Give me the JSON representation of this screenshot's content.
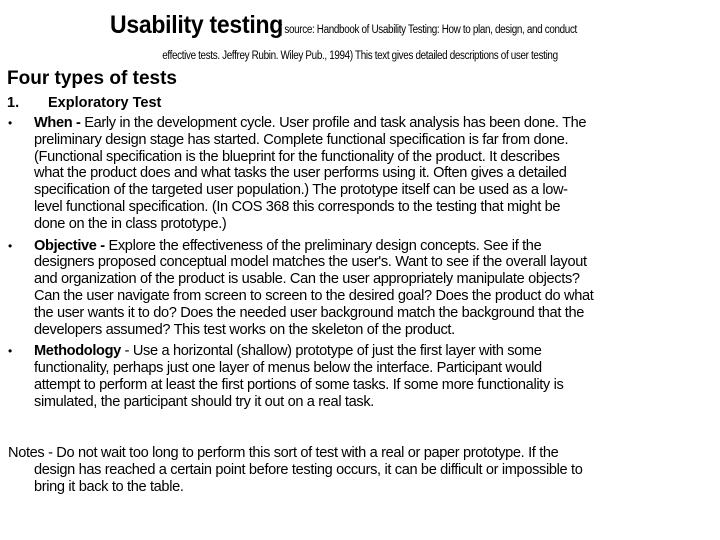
{
  "slide": {
    "title": "Usability testing",
    "source_line1": "( source: Handbook of Usability Testing: How to plan, design, and conduct",
    "source_line2": "effective tests.  Jeffrey Rubin.  Wiley Pub., 1994)  This text gives detailed descriptions of user testing",
    "section_heading": "Four types of tests",
    "test_number": "1.",
    "test_name": "Exploratory Test",
    "bullets": [
      {
        "bullet_glyph": "•",
        "term": "When -",
        "lines": [
          " Early in the development cycle.  User profile and task analysis has been done.  The",
          "preliminary design stage has started. Complete functional specification is far from done.",
          "(Functional specification is the blueprint for the functionality of the product.  It describes",
          "what the product does and what tasks the user performs using it.  Often gives a detailed",
          "specification of the targeted user population.)    The prototype itself can be used as a low-",
          "level  functional specification.  (In COS 368 this corresponds to the testing that might be",
          "done on the in class prototype.)"
        ]
      },
      {
        "bullet_glyph": "•",
        "term": "Objective -",
        "lines": [
          " Explore the effectiveness of the preliminary design concepts.  See if the",
          "designers proposed conceptual model matches the user's.  Want to see if the overall layout",
          "and organization of the product is usable.  Can the user appropriately manipulate objects?",
          "Can the user navigate from screen to screen to the desired goal?  Does the product do what",
          "the user wants it to do?  Does the needed user background match the background that the",
          "developers assumed?  This test works on the skeleton of the product."
        ]
      },
      {
        "bullet_glyph": "•",
        "term": "Methodology",
        "lines": [
          " - Use a horizontal (shallow) prototype of just the first layer with some",
          "functionality, perhaps just one layer of menus below the interface.  Participant would",
          "attempt to perform at least the first portions of some tasks.  If some more functionality is",
          "simulated, the participant should try it out on a real task."
        ]
      }
    ],
    "notes_lines": [
      "Notes - Do not wait too long to perform this sort of test with a real or paper prototype.  If the",
      "design has reached a certain point before testing occurs, it can be difficult or impossible to",
      "bring it back to the table."
    ]
  }
}
